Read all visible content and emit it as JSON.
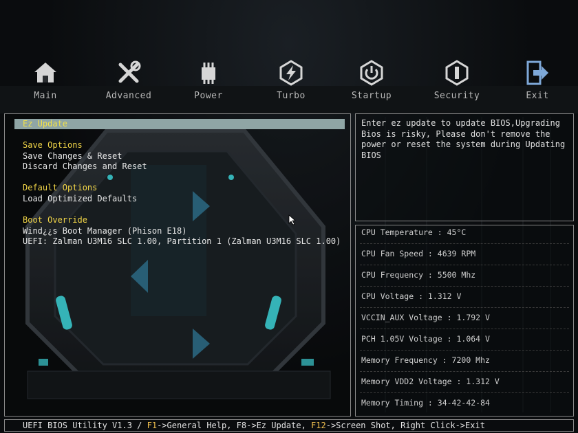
{
  "nav": {
    "items": [
      {
        "label": "Main",
        "icon": "home-icon"
      },
      {
        "label": "Advanced",
        "icon": "tools-icon"
      },
      {
        "label": "Power",
        "icon": "chip-icon"
      },
      {
        "label": "Turbo",
        "icon": "bolt-icon"
      },
      {
        "label": "Startup",
        "icon": "power-icon"
      },
      {
        "label": "Security",
        "icon": "shield-icon"
      },
      {
        "label": "Exit",
        "icon": "exit-icon"
      }
    ],
    "active": "Exit"
  },
  "menu": {
    "ez_update": "Ez Update",
    "save_options": "Save Options",
    "save_changes_reset": "Save Changes & Reset",
    "discard_changes_reset": "Discard Changes and Reset",
    "default_options": "Default Options",
    "load_optimized_defaults": "Load Optimized Defaults",
    "boot_override": "Boot Override",
    "boot_windows": "Wind¿¿s Boot Manager (Phison E18)",
    "boot_uefi": "UEFI: Zalman U3M16 SLC 1.00, Partition 1 (Zalman U3M16 SLC 1.00)"
  },
  "help": {
    "text": "Enter ez update to update BIOS,Upgrading\nBios is risky, Please don't remove the\npower or reset the system during Updating\nBIOS"
  },
  "status": [
    "CPU Temperature : 45°C",
    "CPU Fan Speed : 4639 RPM",
    "CPU Frequency : 5500 Mhz",
    "CPU Voltage : 1.312 V",
    "VCCIN_AUX Voltage : 1.792 V",
    "PCH 1.05V Voltage : 1.064 V",
    "Memory Frequency : 7200 Mhz",
    "Memory VDD2 Voltage : 1.312 V",
    "Memory Timing : 34-42-42-84"
  ],
  "footer": {
    "prefix": "UEFI BIOS Utility V1.3 / ",
    "f1": "F1",
    "f1_text": "->General Help, F8->Ez Update, ",
    "f12": "F12",
    "f12_text": "->Screen Shot, Right Click->Exit"
  },
  "colors": {
    "highlight_bar": "#8fa5a5",
    "section_text": "#f2d648",
    "accent_cyan": "#3fd3d8",
    "exit_icon": "#7ea8d8"
  }
}
